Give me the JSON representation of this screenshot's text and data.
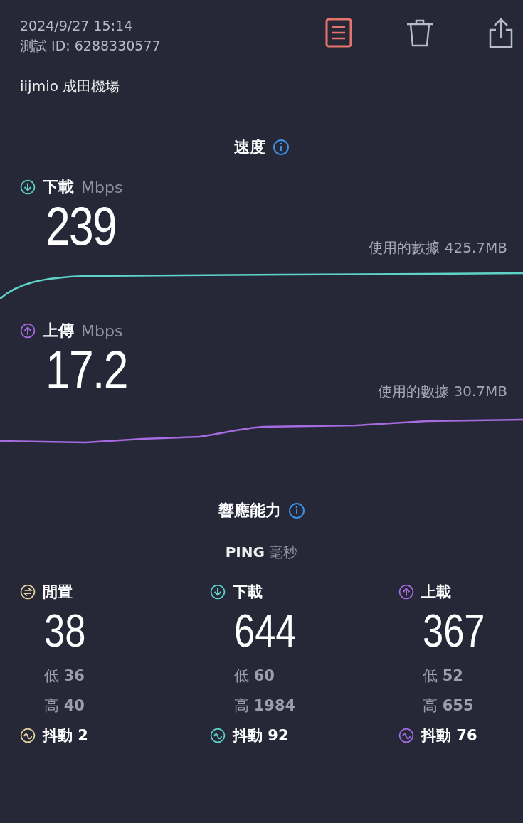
{
  "header": {
    "date": "2024/9/27 15:14",
    "test_id": "測試 ID: 6288330577",
    "location": "iijmio 成田機場"
  },
  "speed": {
    "title": "速度",
    "items": [
      {
        "kind": "download",
        "label": "下載",
        "unit": "Mbps",
        "value": "239",
        "data_used": "使用的數據 425.7MB",
        "color": "#5fd3c8"
      },
      {
        "kind": "upload",
        "label": "上傳",
        "unit": "Mbps",
        "value": "17.2",
        "data_used": "使用的數據 30.7MB",
        "color": "#a66be0"
      }
    ]
  },
  "responsiveness": {
    "title": "響應能力",
    "ping_label": "PING",
    "ping_unit": "毫秒",
    "columns": [
      {
        "kind": "idle",
        "label": "閒置",
        "value": "38",
        "low_label": "低",
        "low": "36",
        "high_label": "高",
        "high": "40",
        "jitter_label": "抖動",
        "jitter": "2",
        "color": "#e6d59c"
      },
      {
        "kind": "download",
        "label": "下載",
        "value": "644",
        "low_label": "低",
        "low": "60",
        "high_label": "高",
        "high": "1984",
        "jitter_label": "抖動",
        "jitter": "92",
        "color": "#5fd3c8"
      },
      {
        "kind": "upload",
        "label": "上載",
        "value": "367",
        "low_label": "低",
        "low": "52",
        "high_label": "高",
        "high": "655",
        "jitter_label": "抖動",
        "jitter": "76",
        "color": "#a66be0"
      }
    ]
  }
}
